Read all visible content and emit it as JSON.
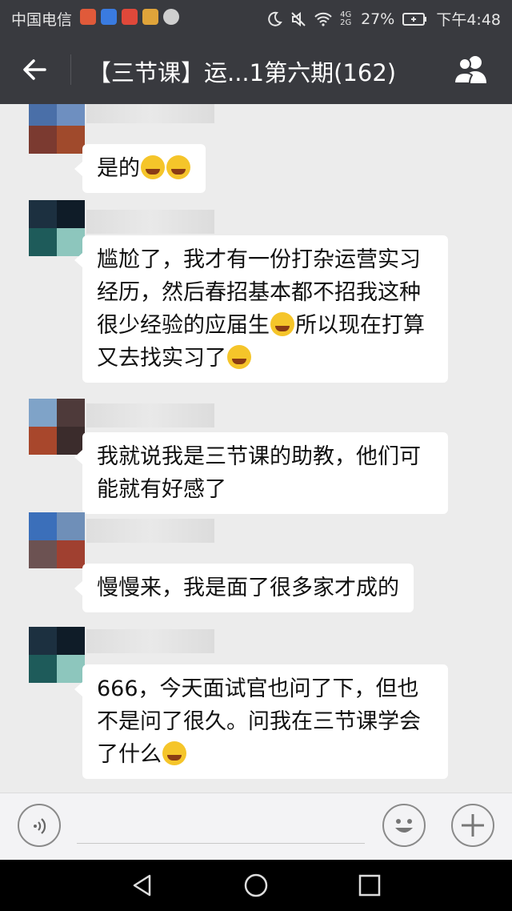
{
  "status_bar": {
    "carrier": "中国电信",
    "battery": "27%",
    "time": "下午4:48",
    "network": "4G 2G",
    "icons": [
      "moon-icon",
      "mute-icon",
      "wifi-icon",
      "battery-icon"
    ]
  },
  "title_bar": {
    "title": "【三节课】运...1第六期(162)",
    "back_icon": "back-arrow-icon",
    "members_icon": "group-members-icon"
  },
  "messages": [
    {
      "text": "是的",
      "emoji_after": [
        "cry-laugh-emoji",
        "cry-laugh-emoji"
      ]
    },
    {
      "lines": [
        "尴尬了，我才有一份打杂运营实习",
        "经历，然后春招基本都不招我这种",
        "很少经验的应届生",
        "所以现在打算",
        "又去找实习了"
      ]
    },
    {
      "lines": [
        "我就说我是三节课的助教，他们可",
        "能就有好感了"
      ]
    },
    {
      "text": "慢慢来，我是面了很多家才成的"
    },
    {
      "lines": [
        "666，今天面试官也问了下，但也",
        "不是问了很久。问我在三节课学会",
        "了什么"
      ]
    }
  ],
  "input_bar": {
    "voice_icon": "voice-icon",
    "emoji_icon": "emoji-icon",
    "plus_icon": "plus-icon"
  },
  "nav_bar": {
    "back_icon": "nav-back-icon",
    "home_icon": "nav-home-icon",
    "recents_icon": "nav-recents-icon"
  },
  "colors": {
    "header_bg": "#393a3f",
    "chat_bg": "#ececec",
    "bubble_bg": "#ffffff"
  }
}
